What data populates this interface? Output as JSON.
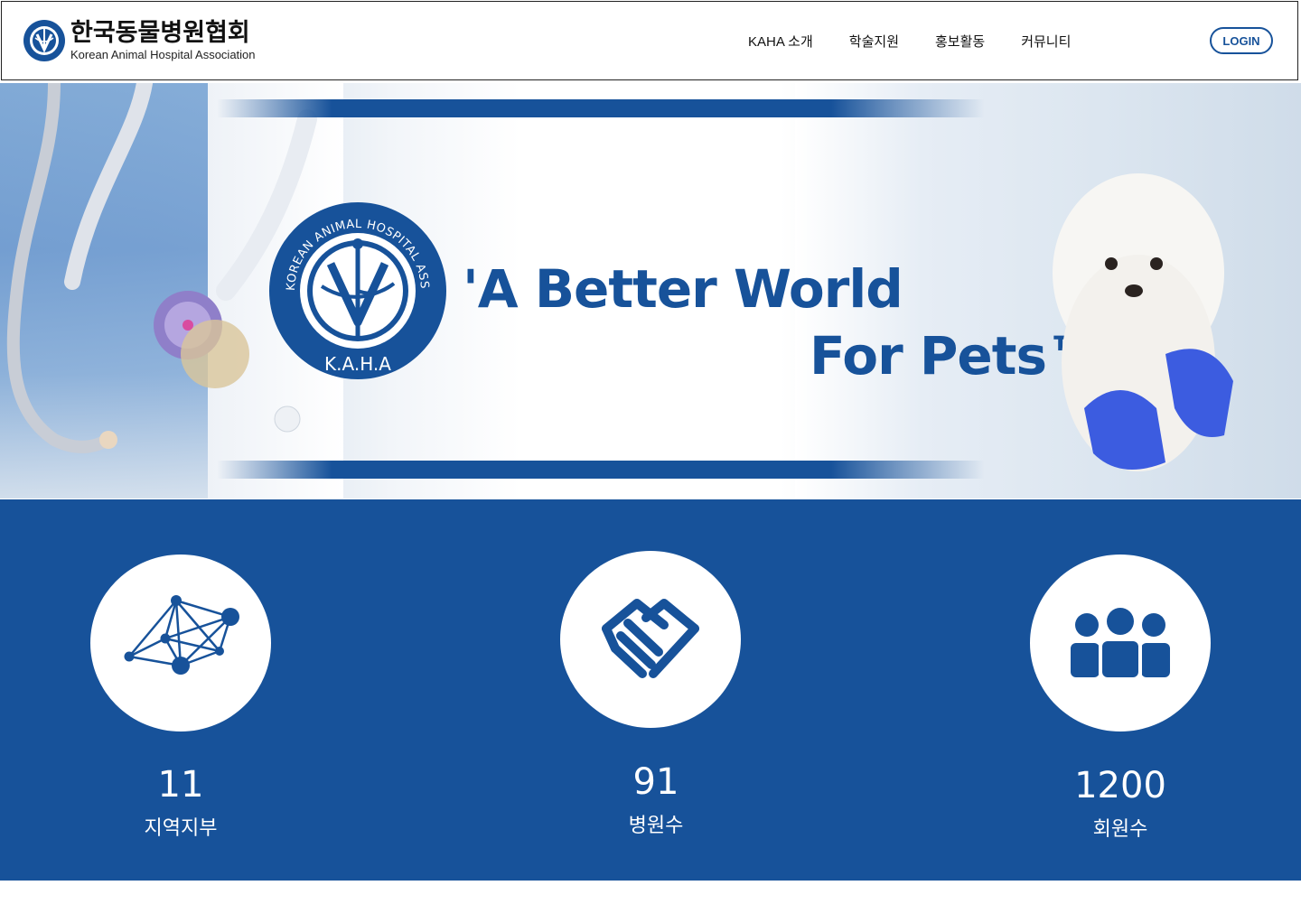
{
  "header": {
    "logo_korean": "한국동물병원협회",
    "logo_english": "Korean Animal Hospital Association",
    "nav": [
      "KAHA 소개",
      "학술지원",
      "홍보활동",
      "커뮤니티"
    ],
    "login_label": "LOGIN"
  },
  "hero": {
    "slogan_line1": "'A Better World",
    "slogan_line2": "For Pets™'",
    "emblem_ring_text": "KOREAN ANIMAL HOSPITAL ASSOCIATION",
    "emblem_initials": "K.A.H.A"
  },
  "stats": [
    {
      "value": "11",
      "label": "지역지부",
      "icon": "network-icon"
    },
    {
      "value": "91",
      "label": "병원수",
      "icon": "handshake-icon"
    },
    {
      "value": "1200",
      "label": "회원수",
      "icon": "people-group-icon"
    }
  ],
  "colors": {
    "brand": "#17529a",
    "white": "#ffffff"
  }
}
